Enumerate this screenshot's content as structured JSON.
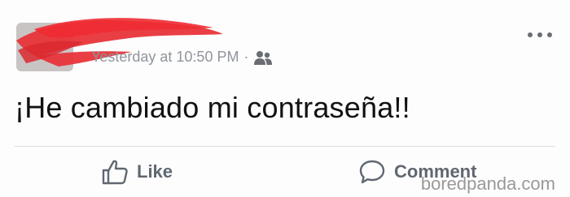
{
  "post": {
    "timestamp": "Yesterday at 10:50 PM",
    "separator": "·",
    "audience_icon": "friends-icon",
    "text": "¡He cambiado mi contraseña!!",
    "more_icon": "more-options-icon"
  },
  "actions": {
    "like_label": "Like",
    "comment_label": "Comment"
  },
  "watermark": "boredpanda.com",
  "colors": {
    "redaction": "#e8343a",
    "meta_text": "#90949c",
    "action_text": "#606770"
  }
}
